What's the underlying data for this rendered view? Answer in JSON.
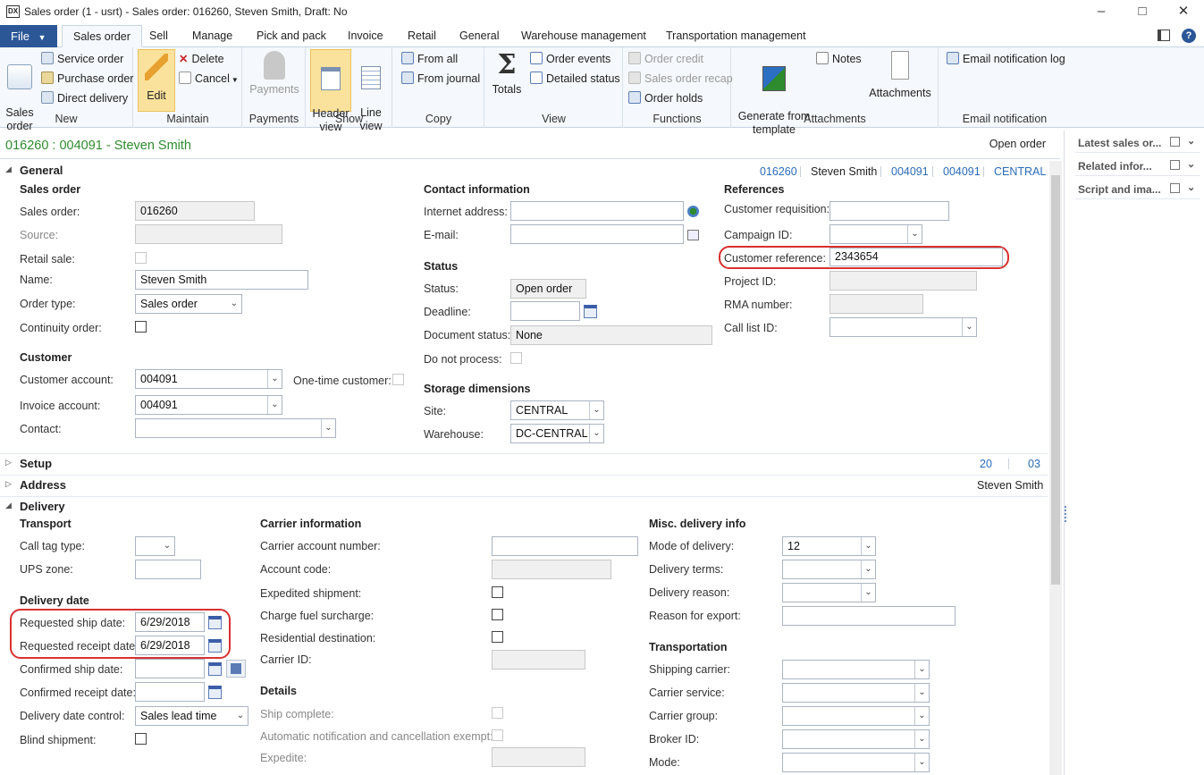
{
  "window": {
    "title": "Sales order (1 - usrt) - Sales order: 016260, Steven Smith, Draft: No",
    "icon_text": "DX",
    "controls": [
      "–",
      "□",
      "✕"
    ]
  },
  "tabs": {
    "file": "File",
    "items": [
      "Sales order",
      "Sell",
      "Manage",
      "Pick and pack",
      "Invoice",
      "Retail",
      "General",
      "Warehouse management",
      "Transportation management"
    ]
  },
  "ribbon": {
    "new": {
      "label": "New",
      "sales_order": "Sales\norder",
      "service_order": "Service order",
      "purchase_order": "Purchase order",
      "direct_delivery": "Direct delivery"
    },
    "maintain": {
      "label": "Maintain",
      "edit": "Edit",
      "delete": "Delete",
      "cancel": "Cancel"
    },
    "payments": {
      "label": "Payments",
      "payments": "Payments"
    },
    "show": {
      "label": "Show",
      "header_view": "Header\nview",
      "line_view": "Line\nview"
    },
    "copy": {
      "label": "Copy",
      "from_all": "From all",
      "from_journal": "From journal"
    },
    "view": {
      "label": "View",
      "totals": "Totals",
      "order_events": "Order events",
      "detailed_status": "Detailed status"
    },
    "functions": {
      "label": "Functions",
      "order_credit": "Order credit",
      "sales_order_recap": "Sales order recap",
      "order_holds": "Order holds"
    },
    "attachments": {
      "label": "Attachments",
      "generate_from_template": "Generate from\ntemplate",
      "notes": "Notes",
      "attachments": "Attachments"
    },
    "email": {
      "label": "Email notification",
      "email_log": "Email notification log"
    }
  },
  "record": {
    "title": "016260 : 004091 - Steven Smith",
    "status": "Open order"
  },
  "factboxes": [
    "Latest sales or...",
    "Related infor...",
    "Script and ima..."
  ],
  "general": {
    "name": "General",
    "summary": [
      "016260",
      "Steven Smith",
      "004091",
      "004091",
      "CENTRAL"
    ],
    "sales_order_group": "Sales order",
    "sales_order_label": "Sales order:",
    "sales_order_value": "016260",
    "source_label": "Source:",
    "retail_sale_label": "Retail sale:",
    "name_label": "Name:",
    "name_value": "Steven Smith",
    "order_type_label": "Order type:",
    "order_type_value": "Sales order",
    "continuity_label": "Continuity order:",
    "customer_group": "Customer",
    "customer_account_label": "Customer account:",
    "customer_account_value": "004091",
    "one_time_label": "One-time customer:",
    "invoice_account_label": "Invoice account:",
    "invoice_account_value": "004091",
    "contact_label": "Contact:",
    "contact_info_group": "Contact information",
    "internet_label": "Internet address:",
    "email_label": "E-mail:",
    "status_group": "Status",
    "status_label": "Status:",
    "status_value": "Open order",
    "deadline_label": "Deadline:",
    "doc_status_label": "Document status:",
    "doc_status_value": "None",
    "do_not_process_label": "Do not process:",
    "storage_group": "Storage dimensions",
    "site_label": "Site:",
    "site_value": "CENTRAL",
    "warehouse_label": "Warehouse:",
    "warehouse_value": "DC-CENTRAL",
    "references_group": "References",
    "cust_req_label": "Customer requisition:",
    "campaign_label": "Campaign ID:",
    "cust_ref_label": "Customer reference:",
    "cust_ref_value": "2343654",
    "project_label": "Project ID:",
    "rma_label": "RMA number:",
    "call_list_label": "Call list ID:"
  },
  "setup": {
    "name": "Setup",
    "summary": [
      "20",
      "03"
    ]
  },
  "address": {
    "name": "Address",
    "summary": "Steven Smith"
  },
  "delivery": {
    "name": "Delivery",
    "transport_group": "Transport",
    "call_tag_label": "Call tag type:",
    "ups_zone_label": "UPS zone:",
    "delivery_date_group": "Delivery date",
    "req_ship_label": "Requested ship date:",
    "req_ship_value": "6/29/2018",
    "req_receipt_label": "Requested receipt date:",
    "req_receipt_value": "6/29/2018",
    "conf_ship_label": "Confirmed ship date:",
    "conf_receipt_label": "Confirmed receipt date:",
    "date_control_label": "Delivery date control:",
    "date_control_value": "Sales lead time",
    "blind_label": "Blind shipment:",
    "carrier_group": "Carrier information",
    "carrier_acct_label": "Carrier account number:",
    "account_code_label": "Account code:",
    "expedited_label": "Expedited shipment:",
    "fuel_label": "Charge fuel surcharge:",
    "residential_label": "Residential destination:",
    "carrier_id_label": "Carrier ID:",
    "details_group": "Details",
    "ship_complete_label": "Ship complete:",
    "auto_notif_label": "Automatic notification and cancellation exempt:",
    "expedite_label": "Expedite:",
    "misc_group": "Misc. delivery info",
    "mode_label": "Mode of delivery:",
    "mode_value": "12",
    "terms_label": "Delivery terms:",
    "reason_label": "Delivery reason:",
    "export_label": "Reason for export:",
    "transportation_group": "Transportation",
    "ship_carrier_label": "Shipping carrier:",
    "carrier_service_label": "Carrier service:",
    "carrier_grp_label": "Carrier group:",
    "broker_label": "Broker ID:",
    "mode2_label": "Mode:"
  },
  "colors": {
    "accent": "#2b5797",
    "title_green": "#2e8b2e",
    "highlight_ring": "#d93030",
    "link": "#2a6cb8"
  }
}
